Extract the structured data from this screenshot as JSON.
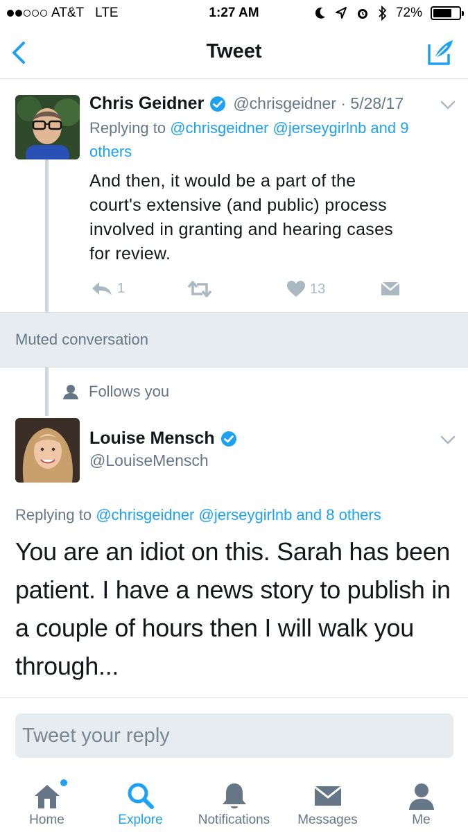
{
  "status_bar": {
    "carrier": "AT&T",
    "network": "LTE",
    "time": "1:27 AM",
    "battery_percent": "72%",
    "battery_level": 0.72
  },
  "nav": {
    "title": "Tweet",
    "back_icon": "chevron-left-icon",
    "compose_icon": "compose-tweet-icon"
  },
  "tweet1": {
    "display_name": "Chris Geidner",
    "handle_date": "@chrisgeidner · 5/28/17",
    "replying_prefix": "Replying to",
    "replying_to": "@chrisgeidner @jerseygirlnb and 9",
    "replying_to_cont": "others",
    "text_lines": [
      "And then, it would be a part of the",
      "court's extensive (and public) process",
      "involved in granting and hearing cases",
      "for review."
    ],
    "reply_count": "1",
    "like_count": "13"
  },
  "muted": {
    "label": "Muted conversation"
  },
  "tweet2": {
    "follows_label": "Follows you",
    "display_name": "Louise Mensch",
    "handle": "@LouiseMensch",
    "replying_prefix": "Replying to",
    "replying_to": "@chrisgeidner @jerseygirlnb and 8 others",
    "text_lines": [
      "You are an idiot on this.  Sarah has been",
      "patient. I have a news story to publish in",
      "a couple of hours then I will walk you",
      "through..."
    ]
  },
  "reply_box": {
    "placeholder": "Tweet your reply"
  },
  "tabs": [
    {
      "label": "Home",
      "icon": "home-icon"
    },
    {
      "label": "Explore",
      "icon": "search-icon"
    },
    {
      "label": "Notifications",
      "icon": "bell-icon"
    },
    {
      "label": "Messages",
      "icon": "envelope-icon"
    },
    {
      "label": "Me",
      "icon": "person-icon"
    }
  ],
  "colors": {
    "accent": "#1da1f2",
    "muted_text": "#657786",
    "action_icon": "#aab8c2",
    "muted_bg": "#e6ecf0"
  }
}
